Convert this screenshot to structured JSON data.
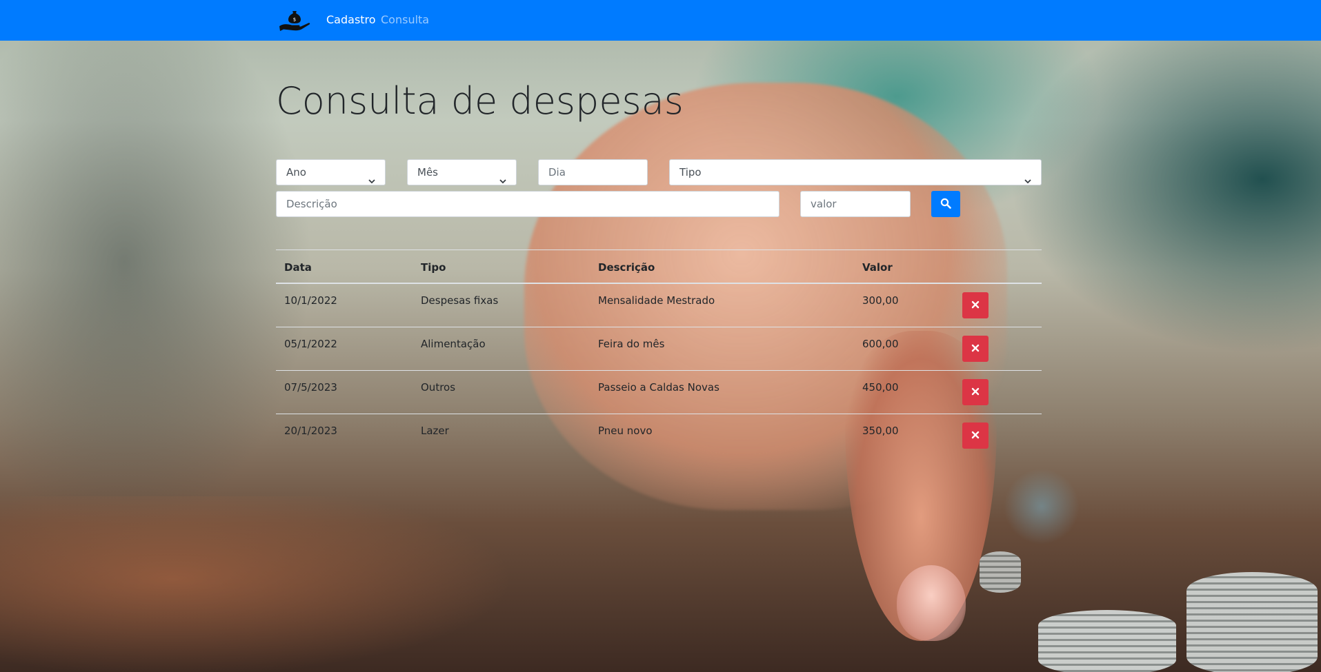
{
  "navbar": {
    "background": "#007bff",
    "brand_icon": "money-bag-hand-icon",
    "links": [
      {
        "label": "Cadastro",
        "active": true
      },
      {
        "label": "Consulta",
        "active": false
      }
    ]
  },
  "page": {
    "title": "Consulta de despesas"
  },
  "filters": {
    "ano": {
      "selected": "Ano"
    },
    "mes": {
      "selected": "Mês"
    },
    "dia": {
      "placeholder": "Dia",
      "value": ""
    },
    "tipo": {
      "selected": "Tipo"
    },
    "descricao": {
      "placeholder": "Descrição",
      "value": ""
    },
    "valor": {
      "placeholder": "valor",
      "value": ""
    },
    "search_icon": "search-icon"
  },
  "table": {
    "headers": [
      "Data",
      "Tipo",
      "Descrição",
      "Valor"
    ],
    "rows": [
      {
        "data": "10/1/2022",
        "tipo": "Despesas fixas",
        "descricao": "Mensalidade Mestrado",
        "valor": "300,00"
      },
      {
        "data": "05/1/2022",
        "tipo": "Alimentação",
        "descricao": "Feira do mês",
        "valor": "600,00"
      },
      {
        "data": "07/5/2023",
        "tipo": "Outros",
        "descricao": "Passeio a Caldas Novas",
        "valor": "450,00"
      },
      {
        "data": "20/1/2023",
        "tipo": "Lazer",
        "descricao": "Pneu novo",
        "valor": "350,00"
      }
    ],
    "delete_icon": "close-icon"
  },
  "colors": {
    "primary": "#007bff",
    "danger": "#dc3545"
  }
}
